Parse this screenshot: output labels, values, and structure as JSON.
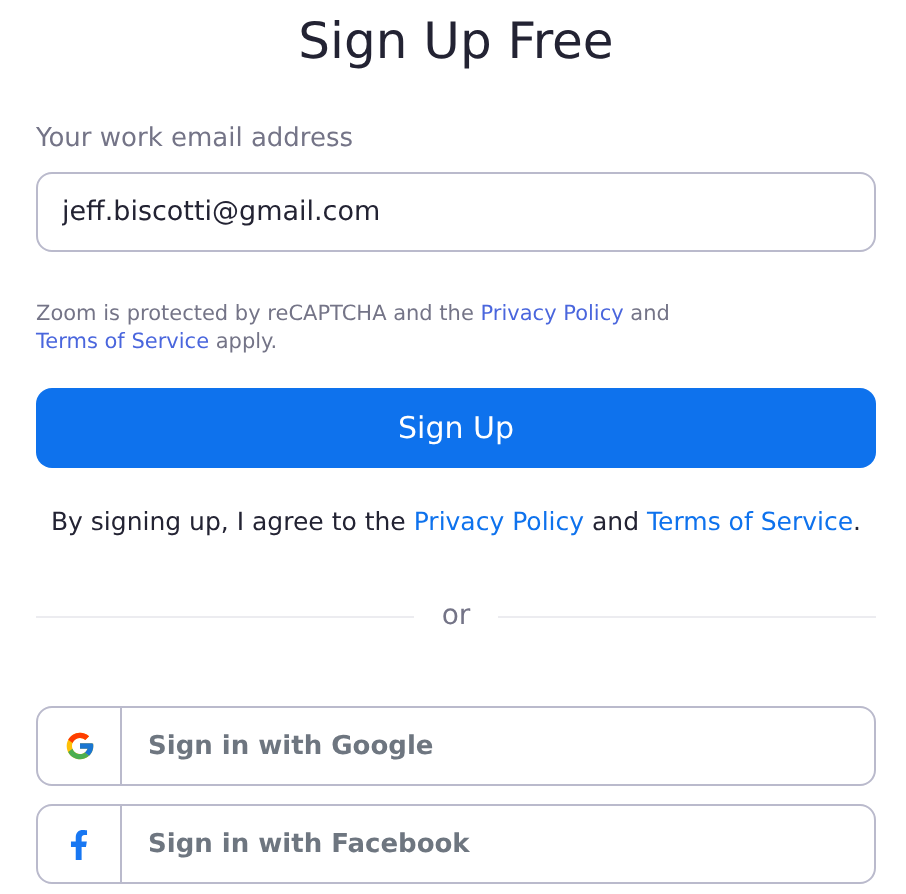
{
  "title": "Sign Up Free",
  "email_field": {
    "label": "Your work email address",
    "value": "jeff.biscotti@gmail.com"
  },
  "recaptcha_notice": [
    {
      "kind": "text",
      "text": "Zoom is protected by reCAPTCHA and the "
    },
    {
      "kind": "link",
      "text": "Privacy Policy"
    },
    {
      "kind": "text",
      "text": " and "
    },
    {
      "kind": "link",
      "text": "Terms of Service"
    },
    {
      "kind": "text",
      "text": " apply."
    }
  ],
  "submit_button": "Sign Up",
  "agreement": [
    {
      "kind": "text",
      "text": "By signing up, I agree to the "
    },
    {
      "kind": "link",
      "text": "Privacy Policy"
    },
    {
      "kind": "text",
      "text": " and "
    },
    {
      "kind": "link",
      "text": "Terms of Service"
    },
    {
      "kind": "text",
      "text": "."
    }
  ],
  "divider": "or",
  "social_buttons": [
    {
      "kind": "google",
      "label": "Sign in with Google"
    },
    {
      "kind": "facebook",
      "label": "Sign in with Facebook"
    }
  ]
}
